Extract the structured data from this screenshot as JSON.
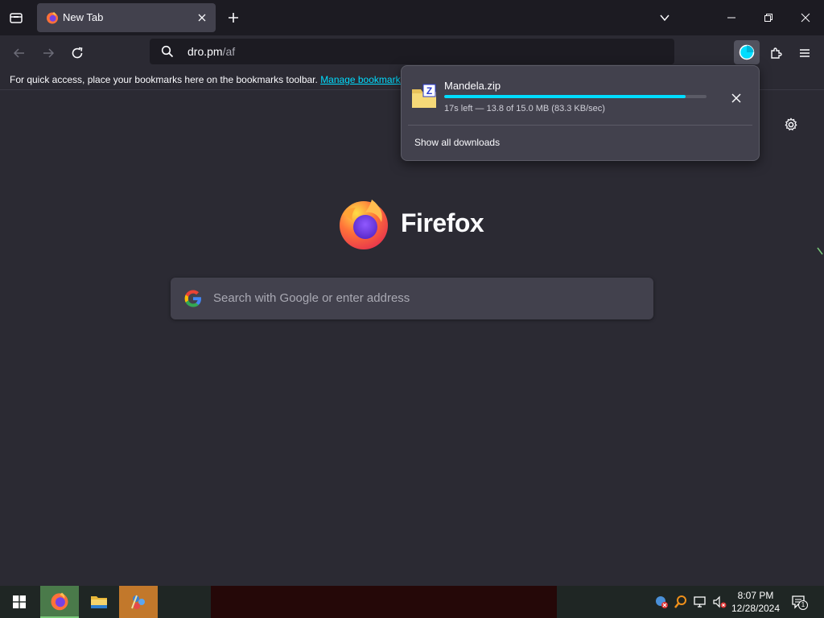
{
  "tabstrip": {
    "tab_title": "New Tab"
  },
  "navbar": {
    "url_host": "dro.pm",
    "url_path": "/af"
  },
  "bookmarks_bar": {
    "message": "For quick access, place your bookmarks here on the bookmarks toolbar. ",
    "link_label": "Manage bookmarks"
  },
  "content": {
    "wordmark": "Firefox",
    "search_placeholder": "Search with Google or enter address"
  },
  "downloads_panel": {
    "file_name": "Mandela.zip",
    "progress_fraction": 0.92,
    "status": "17s left — 13.8 of 15.0 MB (83.3 KB/sec)",
    "show_all_label": "Show all downloads"
  },
  "taskbar": {
    "time": "8:07 PM",
    "date": "12/28/2024",
    "notification_count": "1"
  },
  "colors": {
    "accent": "#00ddff",
    "toolbar": "#2b2a33",
    "tabstrip": "#1c1b22",
    "panel": "#42414d"
  },
  "icons": [
    "tab-list-icon",
    "firefox-icon",
    "close-icon",
    "plus-icon",
    "chevron-down-icon",
    "minimize-icon",
    "restore-icon",
    "back-icon",
    "forward-icon",
    "reload-icon",
    "search-icon",
    "download-icon",
    "extensions-icon",
    "menu-icon",
    "gear-icon",
    "zip-file-icon",
    "google-icon",
    "windows-start-icon",
    "folder-icon",
    "network-icon",
    "volume-muted-icon",
    "notification-icon"
  ]
}
